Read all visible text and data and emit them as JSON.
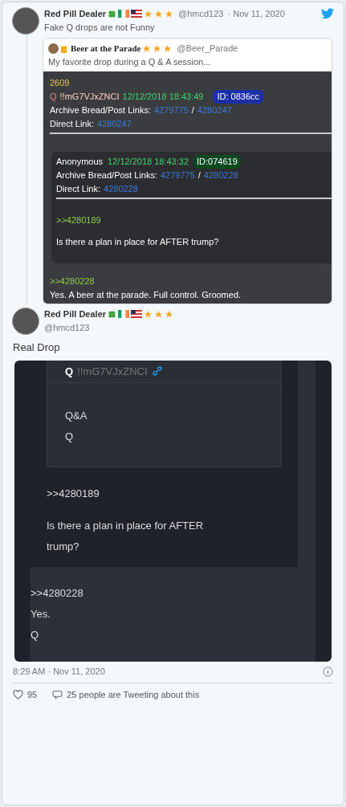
{
  "tweet": {
    "name": "Red Pill Dealer",
    "handle": "@hmcd123",
    "date": "· Nov 11, 2020",
    "text": "Fake Q drops are not Funny",
    "quote": {
      "name": "Beer at the Parade",
      "handle": "@Beer_Parade",
      "text": "My favorite drop during a Q & A session...",
      "drop": {
        "number": "2609",
        "author": "Q",
        "trip": "!!mG7VJxZNCI",
        "timestamp": "12/12/2018 18:43:49",
        "id": "ID: 0836cc",
        "archive_label": "Archive Bread/Post Links:",
        "archive_links": [
          "4279775",
          "4280247"
        ],
        "separator": "/",
        "direct_label": "Direct Link:",
        "direct_link": "4280247",
        "reply": {
          "author": "Anonymous",
          "timestamp": "12/12/2018 18:43:32",
          "id": "ID:074619",
          "archive_label": "Archive Bread/Post Links:",
          "archive_links": [
            "4279775",
            "4280228"
          ],
          "separator": "/",
          "direct_label": "Direct Link:",
          "direct_link": "4280228",
          "ref": ">>4280189",
          "question": "Is there a plan in place for AFTER trump?"
        },
        "ref": ">>4280228",
        "answer": "Yes. A beer at the parade. Full control. Groomed."
      }
    }
  },
  "reply": {
    "name": "Red Pill Dealer",
    "handle": "@hmcd123",
    "text": "Real Drop",
    "drop": {
      "author": "Q",
      "trip": "!!mG7VJxZNCI",
      "quoted_lines": [
        "Q&A",
        "Q"
      ],
      "ref": ">>4280189",
      "question": "Is there a plan in place for AFTER trump?",
      "answer_ref": ">>4280228",
      "answer_lines": [
        "Yes.",
        "Q"
      ]
    },
    "time": "8:29 AM · Nov 11, 2020",
    "likes": "95",
    "talk": "25 people are Tweeting about this"
  }
}
